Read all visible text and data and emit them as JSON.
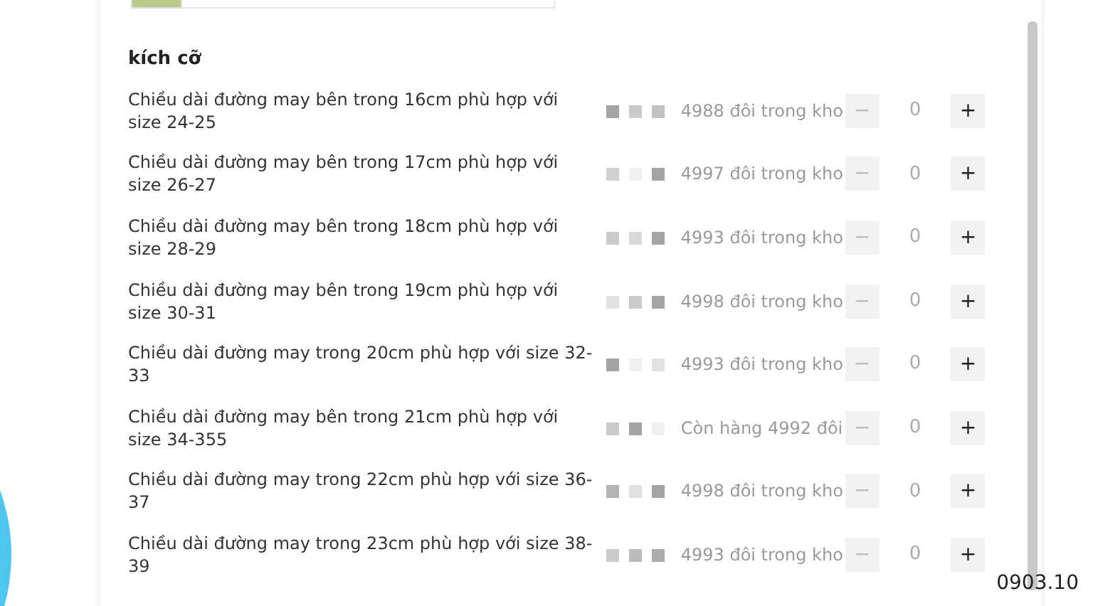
{
  "section_title": "kích cỡ",
  "variants": [
    {
      "label": "Chiều dài đường may bên trong 16cm phù hợp với size 24-25",
      "stock": "4988 đôi trong kho",
      "quantity": "0",
      "minus": "−",
      "plus": "+",
      "minus_disabled": true
    },
    {
      "label": "Chiều dài đường may bên trong 17cm phù hợp với size 26-27",
      "stock": "4997 đôi trong kho",
      "quantity": "0",
      "minus": "−",
      "plus": "+",
      "minus_disabled": true
    },
    {
      "label": "Chiều dài đường may bên trong 18cm phù hợp với size 28-29",
      "stock": "4993 đôi trong kho",
      "quantity": "0",
      "minus": "−",
      "plus": "+",
      "minus_disabled": true
    },
    {
      "label": "Chiều dài đường may bên trong 19cm phù hợp với size 30-31",
      "stock": "4998 đôi trong kho",
      "quantity": "0",
      "minus": "−",
      "plus": "+",
      "minus_disabled": true
    },
    {
      "label": "Chiều dài đường may trong 20cm phù hợp với size 32-33",
      "stock": "4993 đôi trong kho",
      "quantity": "0",
      "minus": "−",
      "plus": "+",
      "minus_disabled": true
    },
    {
      "label": "Chiều dài đường may bên trong 21cm phù hợp với size 34-355",
      "stock": "Còn hàng 4992 đôi",
      "quantity": "0",
      "minus": "−",
      "plus": "+",
      "minus_disabled": true
    },
    {
      "label": "Chiều dài đường may trong 22cm phù hợp với size 36-37",
      "stock": "4998 đôi trong kho",
      "quantity": "0",
      "minus": "−",
      "plus": "+",
      "minus_disabled": true
    },
    {
      "label": "Chiều dài đường may trong 23cm phù hợp với size 38-39",
      "stock": "4993 đôi trong kho",
      "quantity": "0",
      "minus": "−",
      "plus": "+",
      "minus_disabled": true
    }
  ],
  "overlay_text": "0903.10"
}
